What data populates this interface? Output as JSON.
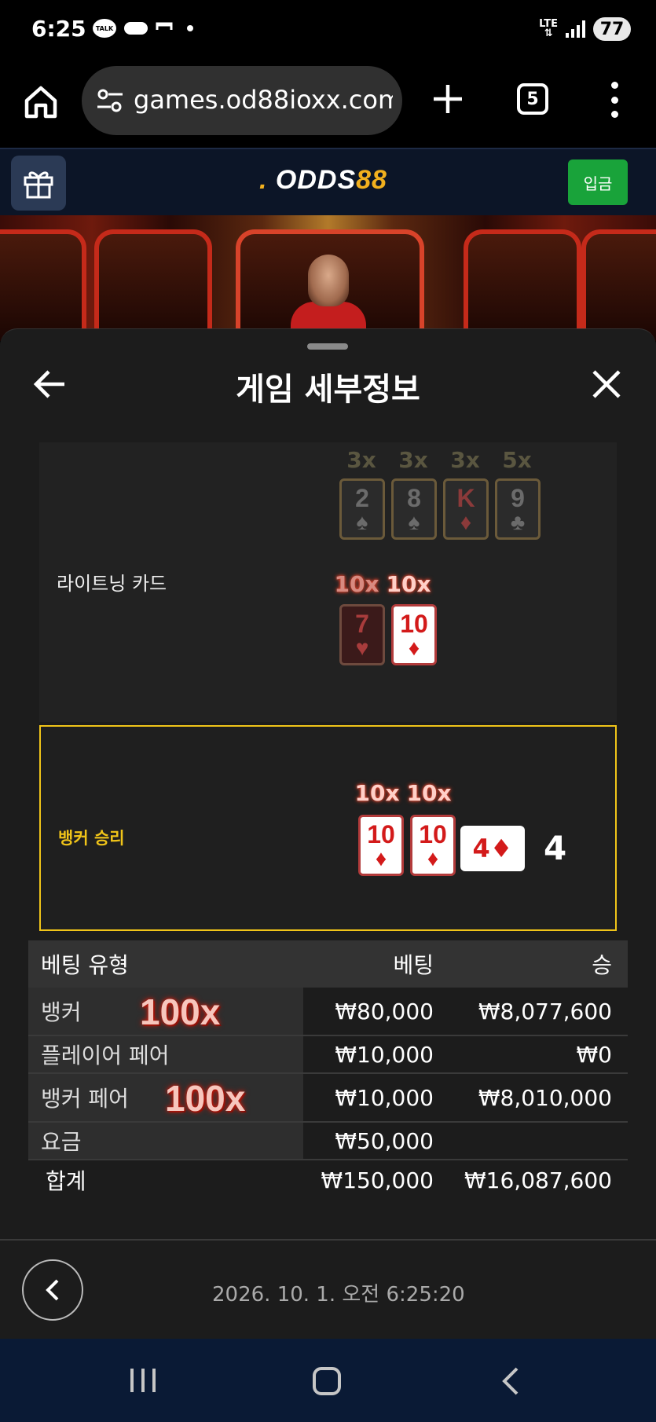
{
  "status_bar": {
    "time": "6:25",
    "talk": "TALK",
    "network": "LTE",
    "battery": "77"
  },
  "browser": {
    "url": "games.od88ioxx.com",
    "tab_count": "5"
  },
  "site": {
    "logo_dot": ".",
    "logo_text": "ODDS",
    "logo_num": "88",
    "deposit_label": "입금"
  },
  "panel": {
    "title": "게임 세부정보"
  },
  "lightning": {
    "label": "라이트닝 카드",
    "row1_multipliers": [
      "3x",
      "3x",
      "3x",
      "5x"
    ],
    "row1_cards": [
      {
        "rank": "2",
        "suit": "♠"
      },
      {
        "rank": "8",
        "suit": "♠"
      },
      {
        "rank": "K",
        "suit": "♦"
      },
      {
        "rank": "9",
        "suit": "♣"
      }
    ],
    "row2_multipliers": [
      "10x",
      "10x"
    ],
    "row2_cards": [
      {
        "rank": "7",
        "suit": "♥"
      },
      {
        "rank": "10",
        "suit": "♦"
      }
    ]
  },
  "result": {
    "label": "뱅커 승리",
    "multipliers": [
      "10x",
      "10x"
    ],
    "cards": [
      {
        "rank": "10",
        "suit": "♦"
      },
      {
        "rank": "10",
        "suit": "♦"
      }
    ],
    "third_card": "4♦",
    "score": "4"
  },
  "bets": {
    "headers": [
      "베팅 유형",
      "베팅",
      "승"
    ],
    "rows": [
      {
        "type": "뱅커",
        "multiplier": "100x",
        "bet": "₩80,000",
        "win": "₩8,077,600"
      },
      {
        "type": "플레이어 페어",
        "multiplier": "",
        "bet": "₩10,000",
        "win": "₩0"
      },
      {
        "type": "뱅커 페어",
        "multiplier": "100x",
        "bet": "₩10,000",
        "win": "₩8,010,000"
      },
      {
        "type": "요금",
        "multiplier": "",
        "bet": "₩50,000",
        "win": ""
      }
    ],
    "total": {
      "label": "합계",
      "bet": "₩150,000",
      "win": "₩16,087,600"
    }
  },
  "footer": {
    "timestamp": "2026. 10. 1. 오전 6:25:20"
  },
  "colors": {
    "accent_gold": "#f0c419",
    "deposit_green": "#19a33a",
    "card_red": "#d31a1a"
  }
}
